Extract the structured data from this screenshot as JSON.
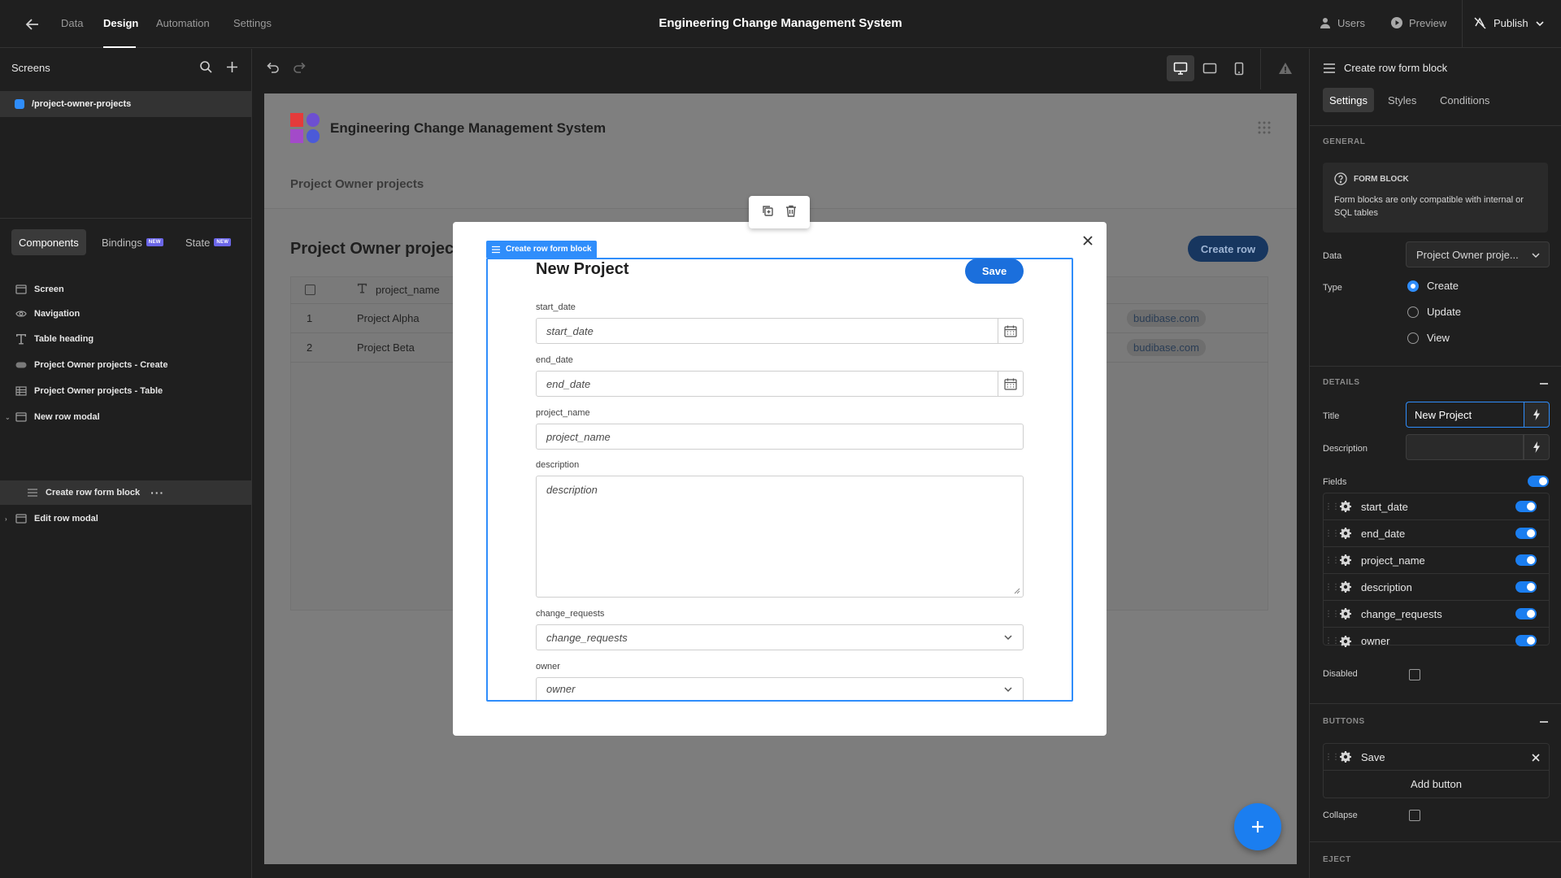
{
  "topbar": {
    "tabs": [
      "Data",
      "Design",
      "Automation",
      "Settings"
    ],
    "active_tab": "Design",
    "app_title": "Engineering Change Management System",
    "users_label": "Users",
    "preview_label": "Preview",
    "publish_label": "Publish"
  },
  "left_panel": {
    "screens_header": "Screens",
    "screens": [
      {
        "route": "/project-owner-projects",
        "color": "#2f8dfb"
      }
    ],
    "tabs": [
      {
        "label": "Components",
        "badge": ""
      },
      {
        "label": "Bindings",
        "badge": "NEW"
      },
      {
        "label": "State",
        "badge": "NEW"
      }
    ],
    "tree": [
      {
        "label": "Screen",
        "icon": "screen-icon"
      },
      {
        "label": "Navigation",
        "icon": "eye-icon"
      },
      {
        "label": "Table heading",
        "icon": "text-icon"
      },
      {
        "label": "Project Owner projects - Create",
        "icon": "button-icon"
      },
      {
        "label": "Project Owner projects - Table",
        "icon": "table-icon"
      },
      {
        "label": "New row modal",
        "icon": "modal-icon"
      },
      {
        "label": "Create row form block",
        "icon": "form-icon"
      },
      {
        "label": "Edit row modal",
        "icon": "modal-icon"
      }
    ]
  },
  "preview": {
    "app_name": "Engineering Change Management System",
    "nav_link": "Project Owner projects",
    "page_heading": "Project Owner projec",
    "create_row_label": "Create row",
    "table": {
      "column": "project_name",
      "rows": [
        {
          "index": "1",
          "project_name": "Project Alpha",
          "email_fragment": "budibase.com"
        },
        {
          "index": "2",
          "project_name": "Project Beta",
          "email_fragment": "budibase.com"
        }
      ]
    },
    "logo_colors": [
      "#e53b3b",
      "#6d4fd1",
      "#a34ac9",
      "#4b5ad8"
    ]
  },
  "form": {
    "frame_label": "Create row form block",
    "title": "New Project",
    "save_label": "Save",
    "fields": {
      "start_date": {
        "label": "start_date",
        "placeholder": "start_date"
      },
      "end_date": {
        "label": "end_date",
        "placeholder": "end_date"
      },
      "project_name": {
        "label": "project_name",
        "placeholder": "project_name"
      },
      "description": {
        "label": "description",
        "placeholder": "description"
      },
      "change_requests": {
        "label": "change_requests",
        "placeholder": "change_requests"
      },
      "owner": {
        "label": "owner",
        "placeholder": "owner"
      }
    }
  },
  "right_panel": {
    "title": "Create row form block",
    "tabs": [
      "Settings",
      "Styles",
      "Conditions"
    ],
    "general": {
      "section": "GENERAL",
      "info_title": "FORM BLOCK",
      "info_text": "Form blocks are only compatible with internal or SQL tables",
      "data_label": "Data",
      "data_value": "Project Owner proje...",
      "type_label": "Type",
      "type_options": [
        "Create",
        "Update",
        "View"
      ],
      "type_selected": "Create"
    },
    "details": {
      "section": "DETAILS",
      "title_label": "Title",
      "title_value": "New Project",
      "description_label": "Description",
      "description_value": "",
      "fields_label": "Fields",
      "fields": [
        "start_date",
        "end_date",
        "project_name",
        "description",
        "change_requests",
        "owner"
      ],
      "disabled_label": "Disabled"
    },
    "buttons": {
      "section": "BUTTONS",
      "items": [
        "Save"
      ],
      "add_label": "Add button",
      "collapse_label": "Collapse"
    },
    "eject": {
      "section": "EJECT"
    },
    "accent": "#2f8dfb"
  }
}
